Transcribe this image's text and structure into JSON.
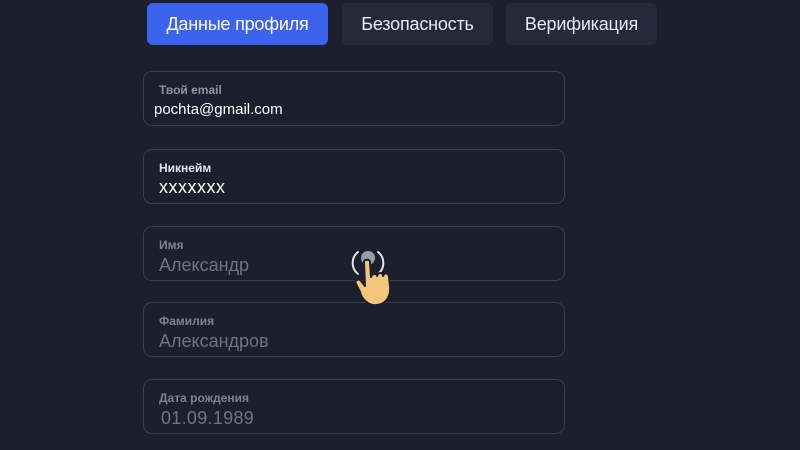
{
  "tabs": [
    {
      "label": "Данные профиля",
      "active": true
    },
    {
      "label": "Безопасность",
      "active": false
    },
    {
      "label": "Верификация",
      "active": false
    }
  ],
  "form": {
    "email": {
      "label": "Твой email",
      "value": "pochta@gmail.com"
    },
    "nickname": {
      "label": "Никнейм",
      "value": "xxxxxxx"
    },
    "first_name": {
      "label": "Имя",
      "placeholder": "Александр"
    },
    "last_name": {
      "label": "Фамилия",
      "placeholder": "Александров"
    },
    "birth_date": {
      "label": "Дата рождения",
      "placeholder": "01.09.1989"
    }
  },
  "colors": {
    "background": "#1c1f2e",
    "tab_active": "#3b63f0",
    "tab_inactive": "#252a3b",
    "field_border": "#3a3f51"
  },
  "cursor": {
    "icon": "pointing-hand-icon"
  }
}
